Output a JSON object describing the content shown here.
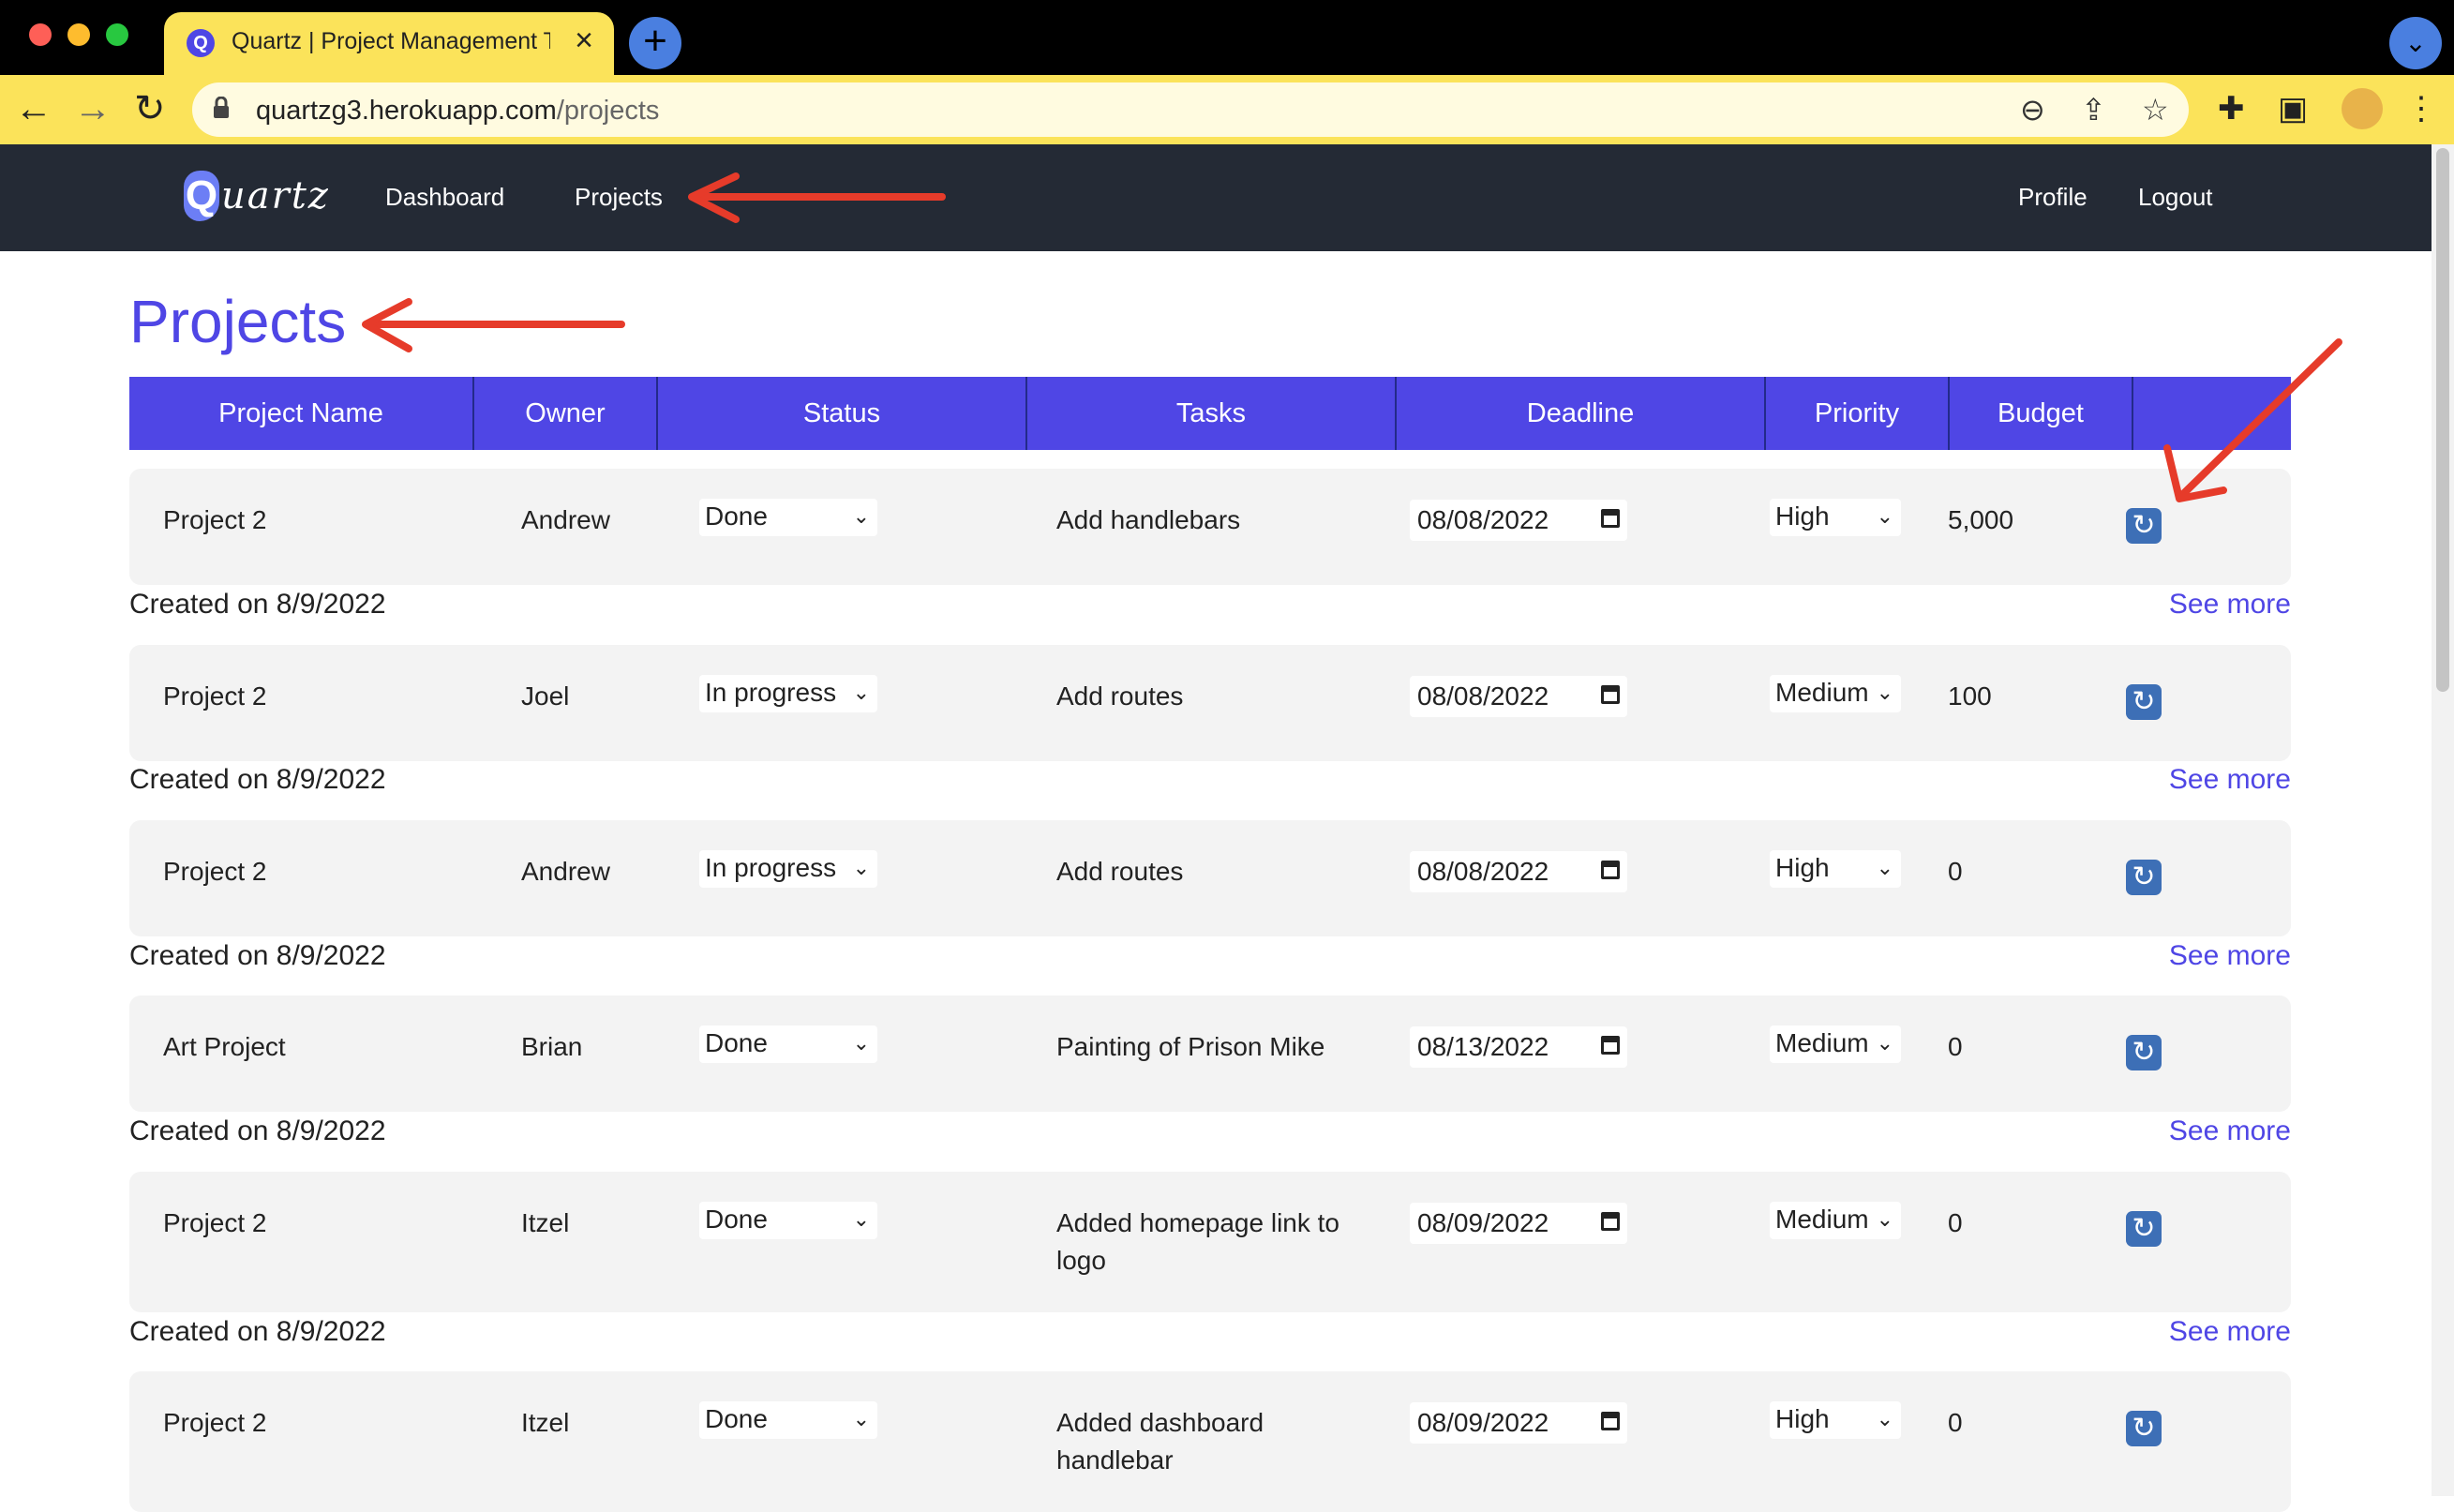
{
  "browser": {
    "tab_title": "Quartz | Project Management T",
    "tab_favicon": "Q",
    "url_host": "quartzg3.herokuapp.com",
    "url_path": "/projects",
    "colors": {
      "chrome": "#fbe35a",
      "tabbar": "#000000"
    }
  },
  "nav": {
    "logo_initial": "Q",
    "logo_rest": "uartz",
    "links": [
      "Dashboard",
      "Projects"
    ],
    "right_links": [
      "Profile",
      "Logout"
    ],
    "bg_color": "#242a35"
  },
  "page": {
    "title": "Projects",
    "accent_color": "#4f46e5"
  },
  "table": {
    "headers": [
      "Project Name",
      "Owner",
      "Status",
      "Tasks",
      "Deadline",
      "Priority",
      "Budget",
      ""
    ],
    "rows": [
      {
        "name": "Project 2",
        "owner": "Andrew",
        "status": "Done",
        "task_line1": "Add handlebars",
        "task_line2": "",
        "deadline": "08/08/2022",
        "priority": "High",
        "budget": "5,000",
        "created": "Created on 8/9/2022",
        "see_more": "See more"
      },
      {
        "name": "Project 2",
        "owner": "Joel",
        "status": "In progress",
        "task_line1": "Add routes",
        "task_line2": "",
        "deadline": "08/08/2022",
        "priority": "Medium",
        "budget": "100",
        "created": "Created on 8/9/2022",
        "see_more": "See more"
      },
      {
        "name": "Project 2",
        "owner": "Andrew",
        "status": "In progress",
        "task_line1": "Add routes",
        "task_line2": "",
        "deadline": "08/08/2022",
        "priority": "High",
        "budget": "0",
        "created": "Created on 8/9/2022",
        "see_more": "See more"
      },
      {
        "name": "Art Project",
        "owner": "Brian",
        "status": "Done",
        "task_line1": "Painting of Prison Mike",
        "task_line2": "",
        "deadline": "08/13/2022",
        "priority": "Medium",
        "budget": "0",
        "created": "Created on 8/9/2022",
        "see_more": "See more"
      },
      {
        "name": "Project 2",
        "owner": "Itzel",
        "status": "Done",
        "task_line1": "Added homepage link to",
        "task_line2": "logo",
        "deadline": "08/09/2022",
        "priority": "Medium",
        "budget": "0",
        "created": "Created on 8/9/2022",
        "see_more": "See more"
      },
      {
        "name": "Project 2",
        "owner": "Itzel",
        "status": "Done",
        "task_line1": "Added dashboard",
        "task_line2": "handlebar",
        "deadline": "08/09/2022",
        "priority": "High",
        "budget": "0",
        "created": "",
        "see_more": ""
      }
    ]
  },
  "icons": {
    "back": "back-arrow-icon",
    "forward": "forward-arrow-icon",
    "reload": "reload-icon",
    "lock": "lock-icon",
    "zoom": "zoom-out-icon",
    "share": "share-icon",
    "bookmark": "star-icon",
    "extensions": "puzzle-icon",
    "sidepanel": "side-panel-icon",
    "menu": "kebab-menu-icon",
    "update": "refresh-icon"
  }
}
